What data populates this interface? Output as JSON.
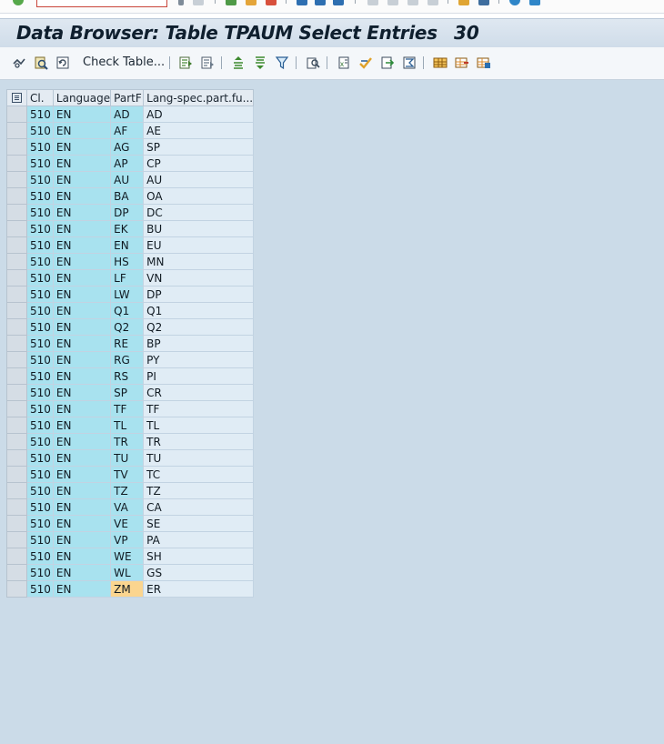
{
  "window": {
    "title": "Data Browser: Table TPAUM Select Entries",
    "entry_count": "30"
  },
  "toolbar": {
    "check_table_label": "Check Table...",
    "icons": [
      "display-icon",
      "details-icon",
      "refresh-icon",
      "check-table",
      "choose-icon",
      "select-icon",
      "sort-ascending-icon",
      "sort-descending-icon",
      "filter-icon",
      "print-preview-icon",
      "export-icon",
      "sum-icon",
      "download-icon",
      "abc-analysis-icon",
      "layout-icon",
      "change-layout-icon",
      "save-layout-icon"
    ]
  },
  "colors": {
    "title_bg": "#cfdce9",
    "content_bg": "#cbdbe8",
    "key_cell_bg": "#a8e2ef",
    "value_cell_bg": "#e0ecf5",
    "focus_cell_bg": "#fbd58f"
  },
  "table": {
    "columns": [
      "Cl.",
      "Language",
      "PartF",
      "Lang-spec.part.fu..."
    ],
    "rows": [
      [
        "510",
        "EN",
        "AD",
        "AD"
      ],
      [
        "510",
        "EN",
        "AF",
        "AE"
      ],
      [
        "510",
        "EN",
        "AG",
        "SP"
      ],
      [
        "510",
        "EN",
        "AP",
        "CP"
      ],
      [
        "510",
        "EN",
        "AU",
        "AU"
      ],
      [
        "510",
        "EN",
        "BA",
        "OA"
      ],
      [
        "510",
        "EN",
        "DP",
        "DC"
      ],
      [
        "510",
        "EN",
        "EK",
        "BU"
      ],
      [
        "510",
        "EN",
        "EN",
        "EU"
      ],
      [
        "510",
        "EN",
        "HS",
        "MN"
      ],
      [
        "510",
        "EN",
        "LF",
        "VN"
      ],
      [
        "510",
        "EN",
        "LW",
        "DP"
      ],
      [
        "510",
        "EN",
        "Q1",
        "Q1"
      ],
      [
        "510",
        "EN",
        "Q2",
        "Q2"
      ],
      [
        "510",
        "EN",
        "RE",
        "BP"
      ],
      [
        "510",
        "EN",
        "RG",
        "PY"
      ],
      [
        "510",
        "EN",
        "RS",
        "PI"
      ],
      [
        "510",
        "EN",
        "SP",
        "CR"
      ],
      [
        "510",
        "EN",
        "TF",
        "TF"
      ],
      [
        "510",
        "EN",
        "TL",
        "TL"
      ],
      [
        "510",
        "EN",
        "TR",
        "TR"
      ],
      [
        "510",
        "EN",
        "TU",
        "TU"
      ],
      [
        "510",
        "EN",
        "TV",
        "TC"
      ],
      [
        "510",
        "EN",
        "TZ",
        "TZ"
      ],
      [
        "510",
        "EN",
        "VA",
        "CA"
      ],
      [
        "510",
        "EN",
        "VE",
        "SE"
      ],
      [
        "510",
        "EN",
        "VP",
        "PA"
      ],
      [
        "510",
        "EN",
        "WE",
        "SH"
      ],
      [
        "510",
        "EN",
        "WL",
        "GS"
      ],
      [
        "510",
        "EN",
        "ZM",
        "ER"
      ]
    ],
    "focused_cell": "ZM"
  }
}
